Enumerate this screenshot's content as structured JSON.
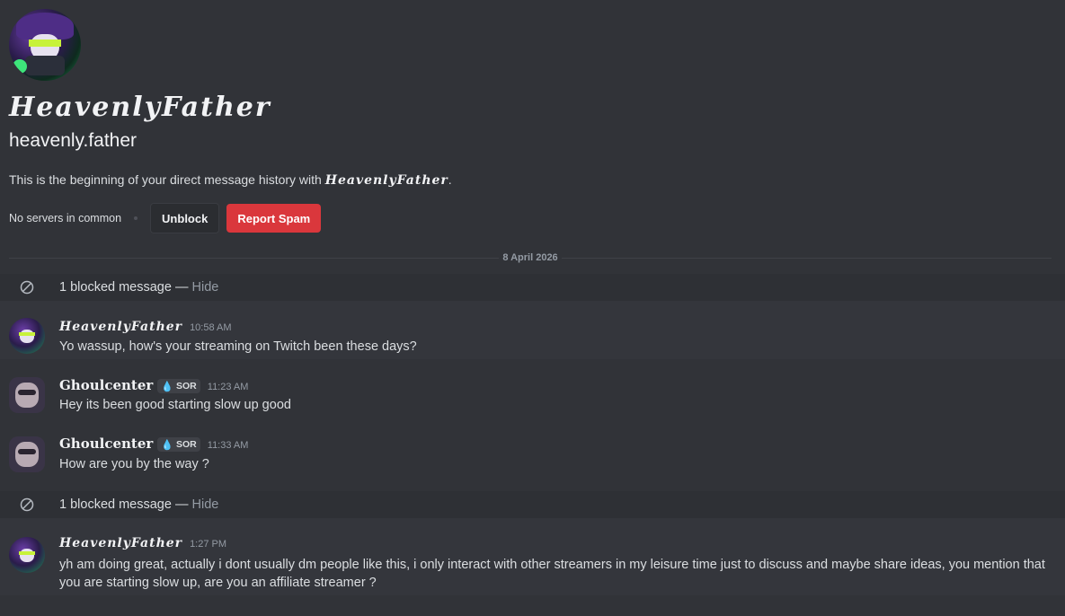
{
  "profile": {
    "display_name": "HeavenlyFather",
    "username": "heavenly.father",
    "intro_prefix": "This is the beginning of your direct message history with ",
    "intro_name": "HeavenlyFather",
    "intro_suffix": ".",
    "mutual_servers": "No servers in common",
    "unblock_label": "Unblock",
    "report_spam_label": "Report Spam"
  },
  "date_divider": "8 April 2026",
  "blocked": {
    "text": "1 blocked message — ",
    "hide_label": "Hide",
    "icon": "blocked-circle-icon"
  },
  "messages": [
    {
      "author": "HeavenlyFather",
      "timestamp": "10:58 AM",
      "text": "Yo wassup, how's your streaming on Twitch been these days?"
    },
    {
      "author": "Ghoulcenter",
      "tag": "SOR",
      "timestamp": "11:23 AM",
      "text": "Hey its been good starting slow up good"
    },
    {
      "author": "Ghoulcenter",
      "tag": "SOR",
      "timestamp": "11:33 AM",
      "text": "How are you by the way ?"
    },
    {
      "author": "HeavenlyFather",
      "timestamp": "1:27 PM",
      "text": "yh am doing great, actually i dont usually dm people like this, i only interact with other streamers in my leisure time just to discuss and maybe share ideas, you mention that you are starting slow up, are you an affiliate streamer ?"
    }
  ],
  "colors": {
    "background": "#313338",
    "report_spam": "#da373c",
    "tag_drop": "#5eb5f2"
  }
}
